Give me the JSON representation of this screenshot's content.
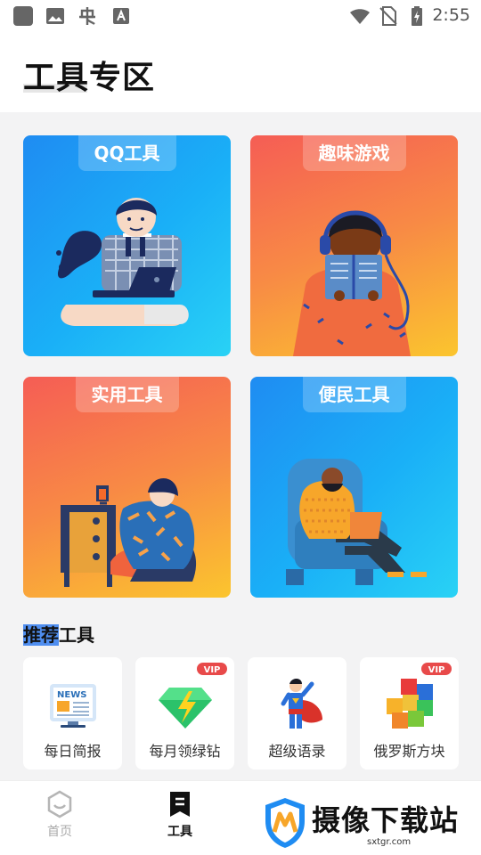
{
  "status_bar": {
    "time": "2:55"
  },
  "header": {
    "title": "工具专区"
  },
  "categories": [
    {
      "label": "QQ工具"
    },
    {
      "label": "趣味游戏"
    },
    {
      "label": "实用工具"
    },
    {
      "label": "便民工具"
    }
  ],
  "recommended": {
    "title_highlight": "推荐",
    "title_rest": "工具",
    "items": [
      {
        "label": "每日简报",
        "icon": "news-icon",
        "vip": false
      },
      {
        "label": "每月领绿钻",
        "icon": "green-diamond-icon",
        "vip": true
      },
      {
        "label": "超级语录",
        "icon": "superhero-icon",
        "vip": false
      },
      {
        "label": "俄罗斯方块",
        "icon": "tetris-blocks-icon",
        "vip": true
      }
    ],
    "vip_badge": "VIP"
  },
  "bottom_nav": [
    {
      "label": "首页",
      "icon": "home-icon",
      "active": false
    },
    {
      "label": "工具",
      "icon": "tools-icon",
      "active": true
    }
  ],
  "watermark": {
    "text": "摄像下载站",
    "url": "sxtgr.com"
  },
  "colors": {
    "accent_blue": "#1f8cf2",
    "accent_orange": "#f88a45",
    "highlight": "#4f8ef0"
  }
}
